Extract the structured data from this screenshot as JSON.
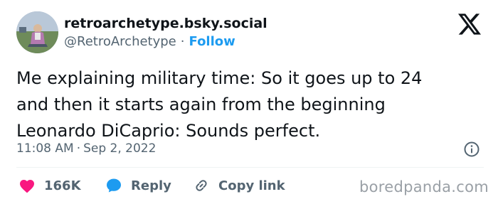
{
  "author": {
    "display_name": "retroarchetype.bsky.social",
    "handle": "@RetroArchetype",
    "separator": "·",
    "follow_label": "Follow"
  },
  "tweet": {
    "lines": [
      "Me explaining military time: So it goes up to 24",
      "and then it starts again from the beginning",
      "Leonardo DiCaprio: Sounds perfect."
    ],
    "time": "11:08 AM",
    "separator": "·",
    "date": "Sep 2, 2022"
  },
  "actions": {
    "like_count": "166K",
    "reply_label": "Reply",
    "copy_link_label": "Copy link"
  },
  "watermark": "boredpanda.com",
  "icons": {
    "platform_logo": "x-logo-icon",
    "info": "info-icon",
    "like": "heart-icon",
    "reply": "speech-bubble-icon",
    "copy": "link-icon"
  },
  "colors": {
    "text": "#0f1419",
    "secondary": "#536471",
    "follow": "#1d9bf0",
    "like": "#f91880",
    "reply": "#1d9bf0"
  }
}
